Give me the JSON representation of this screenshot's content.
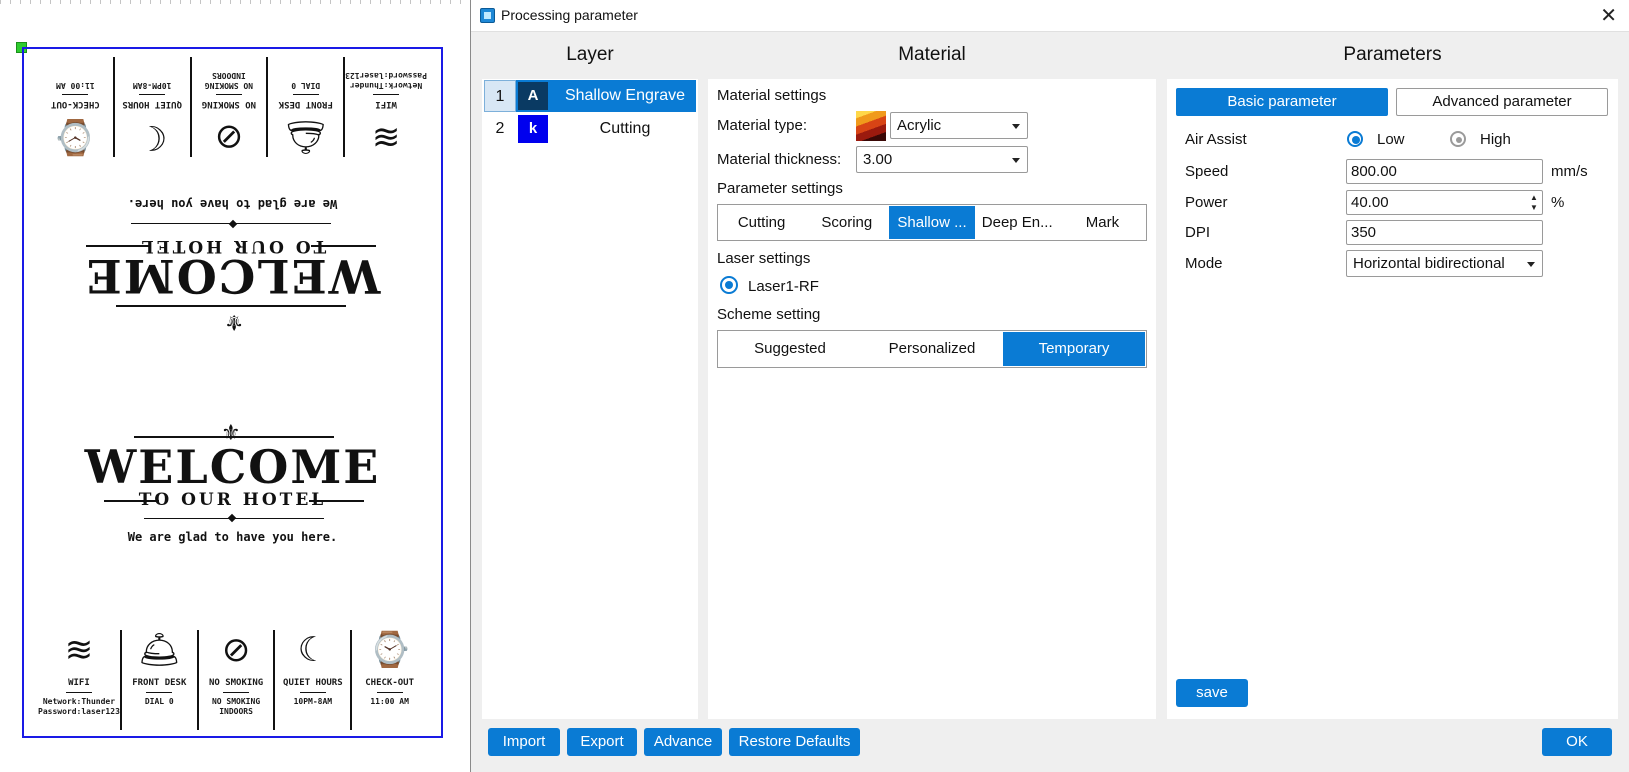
{
  "window": {
    "title": "Processing parameter",
    "close_glyph": "✕"
  },
  "sections": {
    "layer": "Layer",
    "material": "Material",
    "parameters": "Parameters"
  },
  "layers": [
    {
      "num": "1",
      "letter": "A",
      "name": "Shallow Engrave",
      "color": "#0a3a63",
      "selected": true
    },
    {
      "num": "2",
      "letter": "k",
      "name": "Cutting",
      "color": "#0000ee",
      "selected": false
    }
  ],
  "material": {
    "settings_heading": "Material settings",
    "type_label": "Material type:",
    "type_value": "Acrylic",
    "thickness_label": "Material thickness:",
    "thickness_value": "3.00",
    "param_heading": "Parameter settings",
    "param_tabs": [
      "Cutting",
      "Scoring",
      "Shallow ...",
      "Deep En...",
      "Mark"
    ],
    "param_active": 2,
    "laser_heading": "Laser settings",
    "laser_option": "Laser1-RF",
    "scheme_heading": "Scheme setting",
    "scheme_tabs": [
      "Suggested",
      "Personalized",
      "Temporary"
    ],
    "scheme_active": 2
  },
  "parameters": {
    "tab_basic": "Basic parameter",
    "tab_advanced": "Advanced parameter",
    "air_assist_label": "Air Assist",
    "air_low": "Low",
    "air_high": "High",
    "air_selected": "Low",
    "speed_label": "Speed",
    "speed_value": "800.00",
    "speed_unit": "mm/s",
    "power_label": "Power",
    "power_value": "40.00",
    "power_unit": "%",
    "dpi_label": "DPI",
    "dpi_value": "350",
    "mode_label": "Mode",
    "mode_value": "Horizontal bidirectional",
    "save": "save"
  },
  "footer": {
    "import": "Import",
    "export": "Export",
    "advance": "Advance",
    "restore": "Restore Defaults",
    "ok": "OK"
  },
  "canvas": {
    "welcome": "WELCOME",
    "subtitle": "TO OUR HOTEL",
    "glad": "We are glad to have you here.",
    "info": [
      {
        "icon": "wifi-icon",
        "glyph": "≋",
        "label": "WIFI",
        "detail1": "Network:Thunder",
        "detail2": "Password:laser123"
      },
      {
        "icon": "bell-icon",
        "glyph": "🛎",
        "label": "FRONT DESK",
        "detail1": "DIAL 0",
        "detail2": ""
      },
      {
        "icon": "no-smoking-icon",
        "glyph": "⊘",
        "label": "NO SMOKING",
        "detail1": "NO SMOKING",
        "detail2": "INDOORS"
      },
      {
        "icon": "moon-icon",
        "glyph": "☾",
        "label": "QUIET HOURS",
        "detail1": "10PM-8AM",
        "detail2": ""
      },
      {
        "icon": "door-clock-icon",
        "glyph": "⌚",
        "label": "CHECK-OUT",
        "detail1": "11:00 AM",
        "detail2": ""
      }
    ]
  }
}
